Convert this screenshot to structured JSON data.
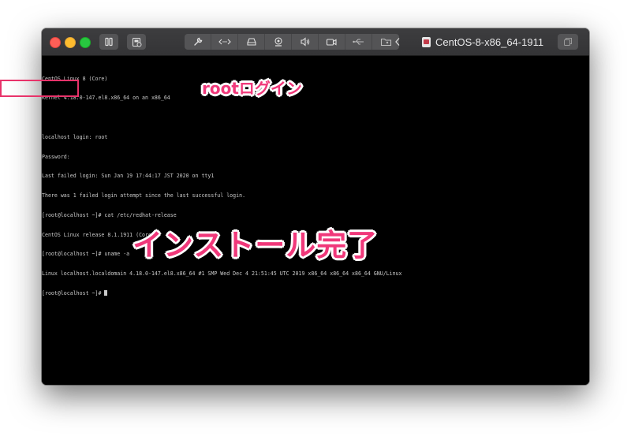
{
  "window": {
    "title": "CentOS-8-x86_64-1911"
  },
  "toolbar": {
    "icons": [
      "pause-icon",
      "snapshot-icon",
      "settings-wrench-icon",
      "network-icon",
      "disk-icon",
      "camera-icon",
      "sound-icon",
      "video-camera-icon",
      "usb-icon",
      "shared-folder-icon",
      "chevron-left-icon",
      "window-restore-icon"
    ]
  },
  "terminal": {
    "lines": [
      "CentOS Linux 8 (Core)",
      "Kernel 4.18.0-147.el8.x86_64 on an x86_64",
      "",
      "localhost login: root",
      "Password:",
      "Last failed login: Sun Jan 19 17:44:17 JST 2020 on tty1",
      "There was 1 failed login attempt since the last successful login.",
      "[root@localhost ~]# cat /etc/redhat-release",
      "CentOS Linux release 8.1.1911 (Core)",
      "[root@localhost ~]# uname -a",
      "Linux localhost.localdomain 4.18.0-147.el8.x86_64 #1 SMP Wed Dec 4 21:51:45 UTC 2019 x86_64 x86_64 x86_64 GNU/Linux",
      "[root@localhost ~]# "
    ]
  },
  "annotations": {
    "root_login": "rootログイン",
    "install_complete": "インストール完了"
  },
  "colors": {
    "annotation": "#f0387a",
    "highlight_box": "#e8336a",
    "terminal_bg": "#000000",
    "terminal_fg": "#c9c9c9"
  }
}
